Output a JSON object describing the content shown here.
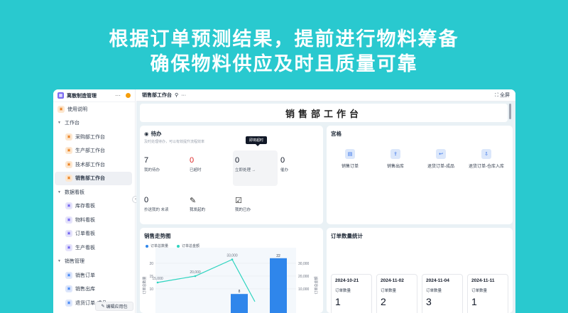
{
  "headline": {
    "line1": "根据订单预测结果，提前进行物料筹备",
    "line2": "确保物料供应及时且质量可靠"
  },
  "sidebar": {
    "app_title": "离散制造管理",
    "more": "···",
    "items": [
      {
        "label": "使用说明",
        "type": "top"
      },
      {
        "label": "工作台",
        "type": "group"
      },
      {
        "label": "采购部工作台",
        "type": "sub"
      },
      {
        "label": "生产部工作台",
        "type": "sub"
      },
      {
        "label": "技术部工作台",
        "type": "sub"
      },
      {
        "label": "销售部工作台",
        "type": "sub-active"
      },
      {
        "label": "数据看板",
        "type": "group"
      },
      {
        "label": "库存看板",
        "type": "sub"
      },
      {
        "label": "物料看板",
        "type": "sub"
      },
      {
        "label": "订单看板",
        "type": "sub"
      },
      {
        "label": "生产看板",
        "type": "sub"
      },
      {
        "label": "销售管理",
        "type": "group"
      },
      {
        "label": "销售订单",
        "type": "sub"
      },
      {
        "label": "销售出库",
        "type": "sub"
      },
      {
        "label": "退货订单-成品",
        "type": "sub"
      }
    ],
    "edit_button": "编辑应用包"
  },
  "topbar": {
    "title": "销售部工作台",
    "more": "···",
    "fullscreen": "全屏"
  },
  "banner": "销售部工作台",
  "todo": {
    "title": "待办",
    "subtitle": "及时处理待办，可以有效提升流程效率",
    "tooltip": "即将超时",
    "stats": [
      {
        "value": "7",
        "label": "我的待办",
        "red": false
      },
      {
        "value": "0",
        "label": "已超时",
        "red": true
      },
      {
        "value": "0",
        "label": "立即处理  →",
        "red": false
      },
      {
        "value": "0",
        "label": "催办",
        "red": false
      },
      {
        "value": "0",
        "label": "抄送我的  未读",
        "red": false
      }
    ],
    "quick": [
      {
        "label": "我发起的",
        "icon": "edit-doc-icon"
      },
      {
        "label": "我的已办",
        "icon": "calendar-check-icon"
      }
    ]
  },
  "grid": {
    "title": "宫格",
    "items": [
      {
        "label": "销售订单",
        "icon": "clipboard-icon"
      },
      {
        "label": "销售出库",
        "icon": "box-out-icon"
      },
      {
        "label": "退货订单-成品",
        "icon": "return-doc-icon"
      },
      {
        "label": "退货订单-仓库入库",
        "icon": "warehouse-in-icon"
      }
    ]
  },
  "chart_data": {
    "type": "bar",
    "title": "销售走势图",
    "series": [
      {
        "name": "订单总数量",
        "type": "bar",
        "color": "#2f86eb",
        "values": [
          0,
          8,
          22
        ]
      },
      {
        "name": "订单总金额",
        "type": "line",
        "color": "#2dd4bf",
        "values": [
          15000,
          20000,
          33000,
          0
        ]
      }
    ],
    "left_axis": {
      "label": "订单总数量",
      "ticks": [
        "20",
        "15",
        "10"
      ],
      "ylim": [
        0,
        25
      ]
    },
    "right_axis": {
      "label": "订单总金额",
      "ticks": [
        "30,000",
        "20,000",
        "10,000"
      ],
      "ylim": [
        0,
        37500
      ]
    },
    "data_labels": {
      "bar": [
        "8",
        "22"
      ],
      "line": [
        "15,000",
        "20,000",
        "33,000"
      ]
    }
  },
  "orders": {
    "title": "订单数量统计",
    "cards": [
      {
        "date": "2024-10-21",
        "label": "订单数量",
        "value": "1"
      },
      {
        "date": "2024-11-02",
        "label": "订单数量",
        "value": "2"
      },
      {
        "date": "2024-11-04",
        "label": "订单数量",
        "value": "3"
      },
      {
        "date": "2024-11-11",
        "label": "订单数量",
        "value": "1"
      }
    ]
  },
  "colors": {
    "background": "#29c9cf",
    "accent": "#2f86eb",
    "line": "#2dd4bf",
    "alert": "#dc2626"
  }
}
